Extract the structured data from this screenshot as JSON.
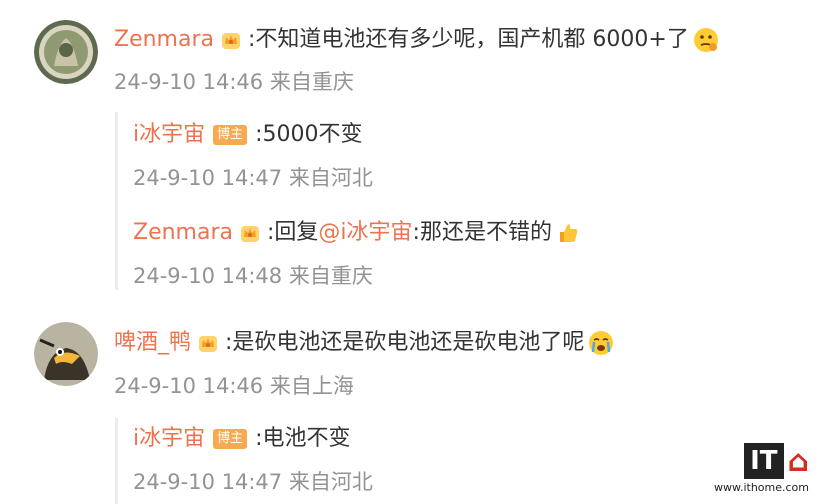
{
  "comments": [
    {
      "user": "Zenmara",
      "text": ":不知道电池还有多少呢，国产机都 6000+了",
      "meta": "24-9-10 14:46 来自重庆",
      "replies": [
        {
          "user": "i冰宇宙",
          "badge": "博主",
          "text": ":5000不变",
          "meta": "24-9-10 14:47 来自河北"
        },
        {
          "user": "Zenmara",
          "prefix": ":回复",
          "mention": "@i冰宇宙",
          "text": ":那还是不错的",
          "meta": "24-9-10 14:48 来自重庆"
        }
      ]
    },
    {
      "user": "啤酒_鸭",
      "text": ":是砍电池还是砍电池还是砍电池了呢",
      "meta": "24-9-10 14:46 来自上海",
      "replies": [
        {
          "user": "i冰宇宙",
          "badge": "博主",
          "text": ":电池不变",
          "meta": "24-9-10 14:47 来自河北"
        }
      ]
    }
  ],
  "watermark": {
    "logo": "IT",
    "site": "www.ithome.com"
  },
  "colors": {
    "username": "#eb7350",
    "meta": "#939393",
    "badge": "#f7a94f"
  }
}
